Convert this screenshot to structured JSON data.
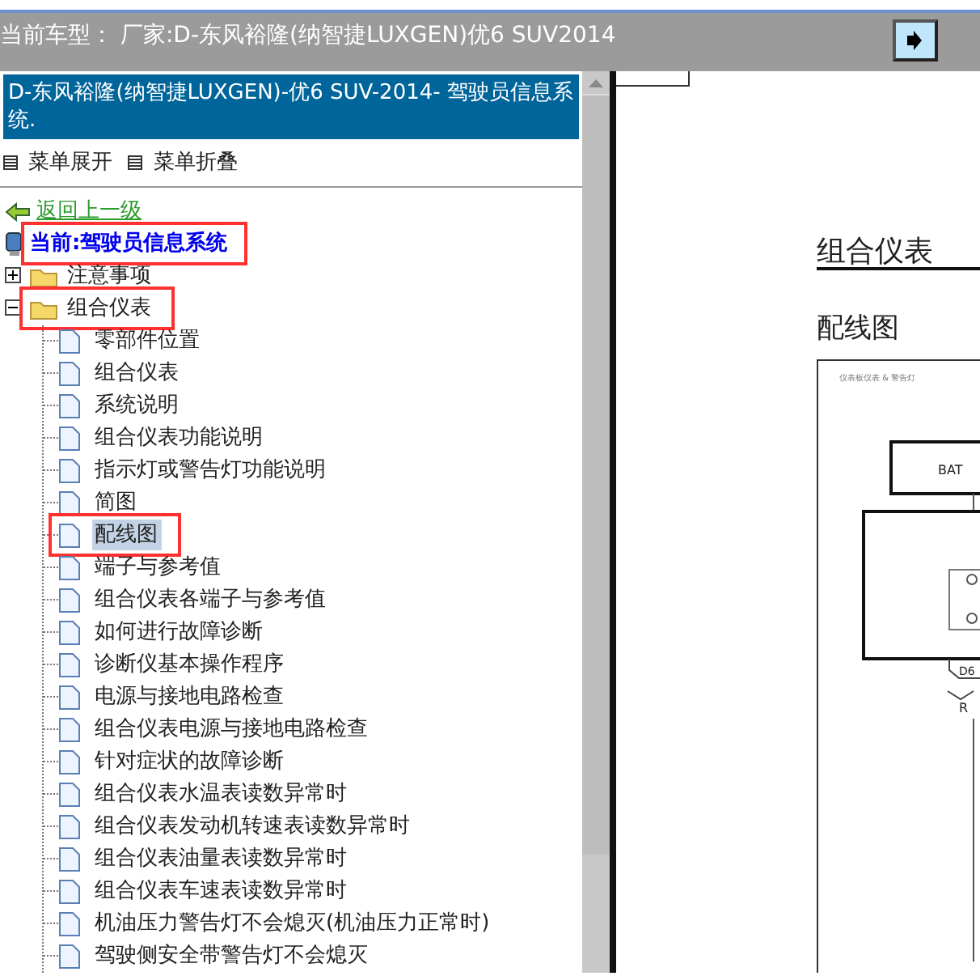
{
  "model_bar": {
    "label": "当前车型：",
    "value": "厂家:D-东风裕隆(纳智捷LUXGEN)优6 SUV2014"
  },
  "panel_title": "D-东风裕隆(纳智捷LUXGEN)-优6 SUV-2014- 驾驶员信息系统.",
  "menu_actions": [
    "菜单展开",
    "菜单折叠"
  ],
  "back_link": "返回上一级",
  "current": {
    "text": "当前:驾驶员信息系统",
    "marked": true
  },
  "tree": [
    {
      "label": "注意事项",
      "expanded": false,
      "marked": false
    },
    {
      "label": "组合仪表",
      "expanded": true,
      "marked": true,
      "children": [
        {
          "label": "零部件位置",
          "selected": false,
          "marked": false
        },
        {
          "label": "组合仪表",
          "selected": false,
          "marked": false
        },
        {
          "label": "系统说明",
          "selected": false,
          "marked": false
        },
        {
          "label": "组合仪表功能说明",
          "selected": false,
          "marked": false
        },
        {
          "label": "指示灯或警告灯功能说明",
          "selected": false,
          "marked": false
        },
        {
          "label": "简图",
          "selected": false,
          "marked": false
        },
        {
          "label": "配线图",
          "selected": true,
          "marked": true
        },
        {
          "label": "端子与参考值",
          "selected": false,
          "marked": false
        },
        {
          "label": "组合仪表各端子与参考值",
          "selected": false,
          "marked": false
        },
        {
          "label": "如何进行故障诊断",
          "selected": false,
          "marked": false
        },
        {
          "label": "诊断仪基本操作程序",
          "selected": false,
          "marked": false
        },
        {
          "label": "电源与接地电路检查",
          "selected": false,
          "marked": false
        },
        {
          "label": "组合仪表电源与接地电路检查",
          "selected": false,
          "marked": false
        },
        {
          "label": "针对症状的故障诊断",
          "selected": false,
          "marked": false
        },
        {
          "label": "组合仪表水温表读数异常时",
          "selected": false,
          "marked": false
        },
        {
          "label": "组合仪表发动机转速表读数异常时",
          "selected": false,
          "marked": false
        },
        {
          "label": "组合仪表油量表读数异常时",
          "selected": false,
          "marked": false
        },
        {
          "label": "组合仪表车速表读数异常时",
          "selected": false,
          "marked": false
        },
        {
          "label": "机油压力警告灯不会熄灭(机油压力正常时)",
          "selected": false,
          "marked": false
        },
        {
          "label": "驾驶侧安全带警告灯不会熄灭",
          "selected": false,
          "marked": false
        }
      ]
    }
  ],
  "document": {
    "heading": "组合仪表",
    "subheading": "配线图",
    "diagram_caption": "仪表板仪表 & 警告灯",
    "labels": [
      "BAT",
      "D6",
      "R"
    ]
  }
}
